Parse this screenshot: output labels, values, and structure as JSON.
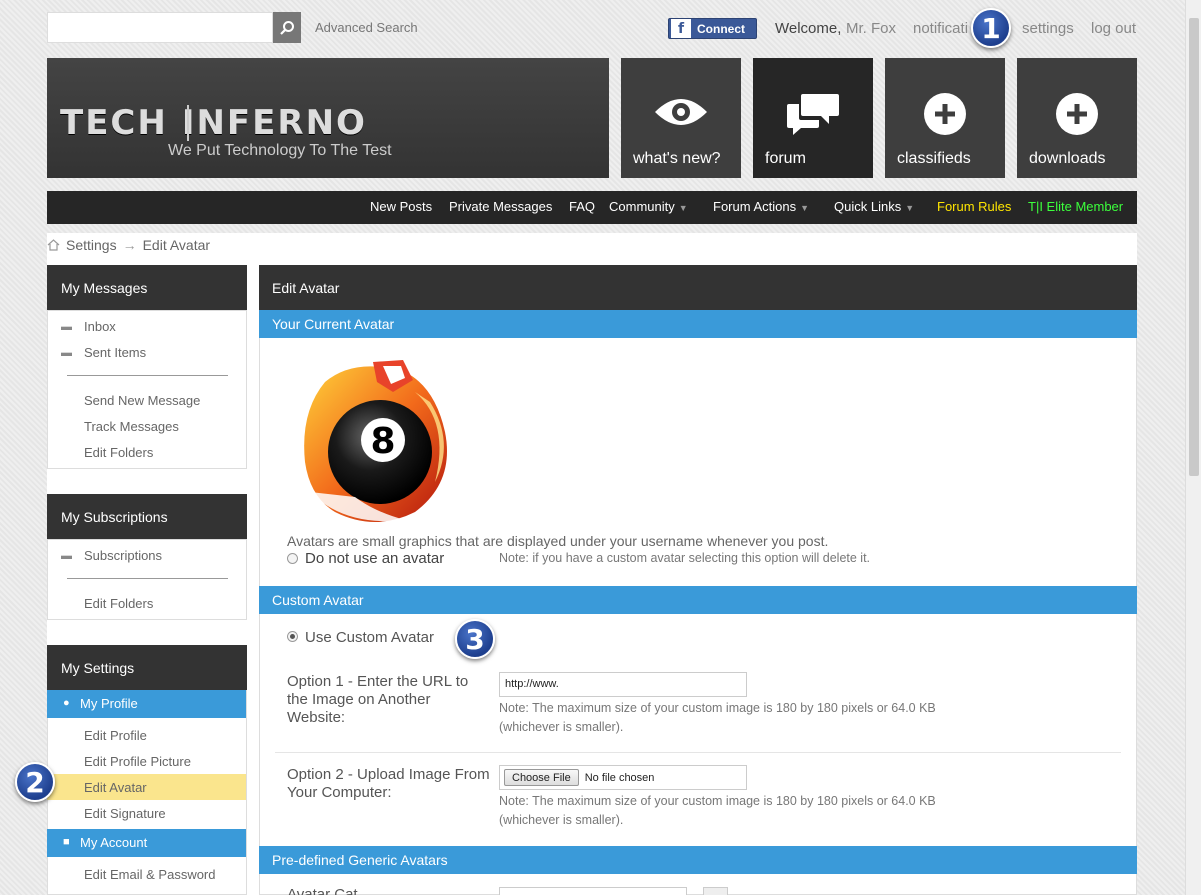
{
  "topbar": {
    "search_placeholder": "",
    "advanced_search": "Advanced Search",
    "fb_connect": "Connect",
    "welcome": "Welcome,",
    "username": "Mr. Fox",
    "notifications": "notificati",
    "settings": "settings",
    "logout": "log out"
  },
  "callouts": {
    "one": "1",
    "two": "2",
    "three": "3"
  },
  "header": {
    "logo_left": "TECH",
    "logo_right": "INFERNO",
    "tagline": "We Put Technology To The Test",
    "tiles": [
      {
        "label": "what's new?",
        "icon": "eye-icon"
      },
      {
        "label": "forum",
        "icon": "chat-bubbles-icon"
      },
      {
        "label": "classifieds",
        "icon": "plus-circle-icon"
      },
      {
        "label": "downloads",
        "icon": "plus-circle-icon"
      }
    ]
  },
  "navbar": {
    "new_posts": "New Posts",
    "private_messages": "Private Messages",
    "faq": "FAQ",
    "community": "Community",
    "forum_actions": "Forum Actions",
    "quick_links": "Quick Links",
    "forum_rules": "Forum Rules",
    "elite": "T|I Elite Member"
  },
  "breadcrumb": {
    "settings": "Settings",
    "current": "Edit Avatar"
  },
  "sidebar": {
    "my_messages": "My Messages",
    "inbox": "Inbox",
    "sent_items": "Sent Items",
    "send_new_message": "Send New Message",
    "track_messages": "Track Messages",
    "edit_folders": "Edit Folders",
    "my_subscriptions": "My Subscriptions",
    "subscriptions": "Subscriptions",
    "edit_folders_2": "Edit Folders",
    "my_settings": "My Settings",
    "my_profile": "My Profile",
    "edit_profile": "Edit Profile",
    "edit_profile_picture": "Edit Profile Picture",
    "edit_avatar": "Edit Avatar",
    "edit_signature": "Edit Signature",
    "my_account": "My Account",
    "edit_email_password": "Edit Email & Password"
  },
  "main": {
    "title": "Edit Avatar",
    "current_avatar": "Your Current Avatar",
    "avatar_desc": "Avatars are small graphics that are displayed under your username whenever you post.",
    "no_avatar": "Do not use an avatar",
    "no_avatar_note": "Note: if you have a custom avatar selecting this option will delete it.",
    "custom_avatar": "Custom Avatar",
    "use_custom": "Use Custom Avatar",
    "option1_l1": "Option 1 - Enter the URL to",
    "option1_l2": "the Image on Another",
    "option1_l3": "Website:",
    "url_value": "http://www.",
    "size_note_l1": "Note: The maximum size of your custom image is 180 by 180 pixels or 64.0 KB",
    "size_note_l2": "(whichever is smaller).",
    "option2_l1": "Option 2 - Upload Image From",
    "option2_l2": "Your Computer:",
    "choose_file": "Choose File",
    "no_file": "No file chosen",
    "predefined": "Pre-defined Generic Avatars",
    "avatar_category": "Avatar Cat..."
  }
}
